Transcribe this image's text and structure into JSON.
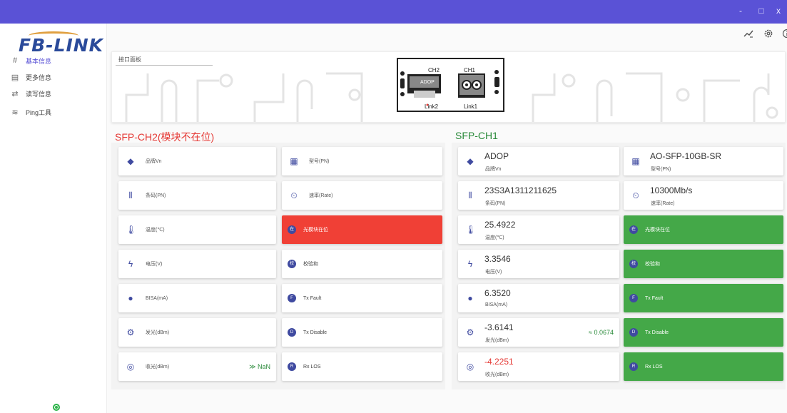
{
  "window": {
    "min": "-",
    "max": "□",
    "close": "x"
  },
  "logo": {
    "text": "FB-LINK"
  },
  "sidebar": {
    "items": [
      {
        "icon": "#",
        "label": "基本信息"
      },
      {
        "icon": "▤",
        "label": "更多信息"
      },
      {
        "icon": "⇄",
        "label": "读写信息"
      },
      {
        "icon": "≋",
        "label": "Ping工具"
      }
    ]
  },
  "topbar": {
    "icons": [
      "chart-edit-icon",
      "settings-icon",
      "info-icon"
    ]
  },
  "panel": {
    "title": "接口面板",
    "ch2": "CH2",
    "ch1": "CH1",
    "link2": "Link2",
    "link1": "Link1",
    "brand": "ADOP"
  },
  "ch2": {
    "title": "SFP-CH2(模块不在位)",
    "left": [
      {
        "icon": "tag-icon",
        "label": "品牌Vn"
      },
      {
        "icon": "barcode-icon",
        "label": "条码(PN)"
      },
      {
        "icon": "thermometer-icon",
        "label": "温度(℃)"
      },
      {
        "icon": "bolt-icon",
        "label": "电压(V)"
      },
      {
        "icon": "bias-icon",
        "label": "BISA(mA)"
      },
      {
        "icon": "gear-icon",
        "label": "发光(dBm)"
      },
      {
        "icon": "receive-icon",
        "label": "收光(dBm)",
        "trend": "≫ NaN"
      }
    ],
    "right": [
      {
        "icon": "table-icon",
        "label": "型号(PN)"
      },
      {
        "icon": "timer-icon",
        "label": "速率(Rate)"
      },
      {
        "badge": "在",
        "label": "光模块在位"
      },
      {
        "badge": "校",
        "label": "校验和"
      },
      {
        "badge": "F",
        "label": "Tx Fault"
      },
      {
        "badge": "D",
        "label": "Tx Disable"
      },
      {
        "badge": "R",
        "label": "Rx LOS"
      }
    ]
  },
  "ch1": {
    "title": "SFP-CH1",
    "left": [
      {
        "icon": "tag-icon",
        "value": "ADOP",
        "label": "品牌Vn"
      },
      {
        "icon": "barcode-icon",
        "value": "23S3A1311211625",
        "label": "条码(PN)"
      },
      {
        "icon": "thermometer-icon",
        "value": "25.4922",
        "label": "温度(℃)"
      },
      {
        "icon": "bolt-icon",
        "value": "3.3546",
        "label": "电压(V)"
      },
      {
        "icon": "bias-icon",
        "value": "6.3520",
        "label": "BISA(mA)"
      },
      {
        "icon": "gear-icon",
        "value": "-3.6141",
        "label": "发光(dBm)",
        "trend": "≈ 0.0674"
      },
      {
        "icon": "receive-icon",
        "value": "-4.2251",
        "label": "收光(dBm)"
      }
    ],
    "right": [
      {
        "icon": "table-icon",
        "value": "AO-SFP-10GB-SR",
        "label": "型号(PN)"
      },
      {
        "icon": "timer-icon",
        "value": "10300Mb/s",
        "label": "速率(Rate)"
      },
      {
        "badge": "在",
        "label": "光模块在位"
      },
      {
        "badge": "校",
        "label": "校验和"
      },
      {
        "badge": "F",
        "label": "Tx Fault"
      },
      {
        "badge": "D",
        "label": "Tx Disable"
      },
      {
        "badge": "R",
        "label": "Rx LOS"
      }
    ]
  },
  "colors": {
    "titlebar": "#5a52d6",
    "error": "#f04036",
    "ok": "#44a848",
    "negative": "#e53935",
    "ch2_title": "#e53935",
    "ch1_title": "#2a8a3a"
  }
}
